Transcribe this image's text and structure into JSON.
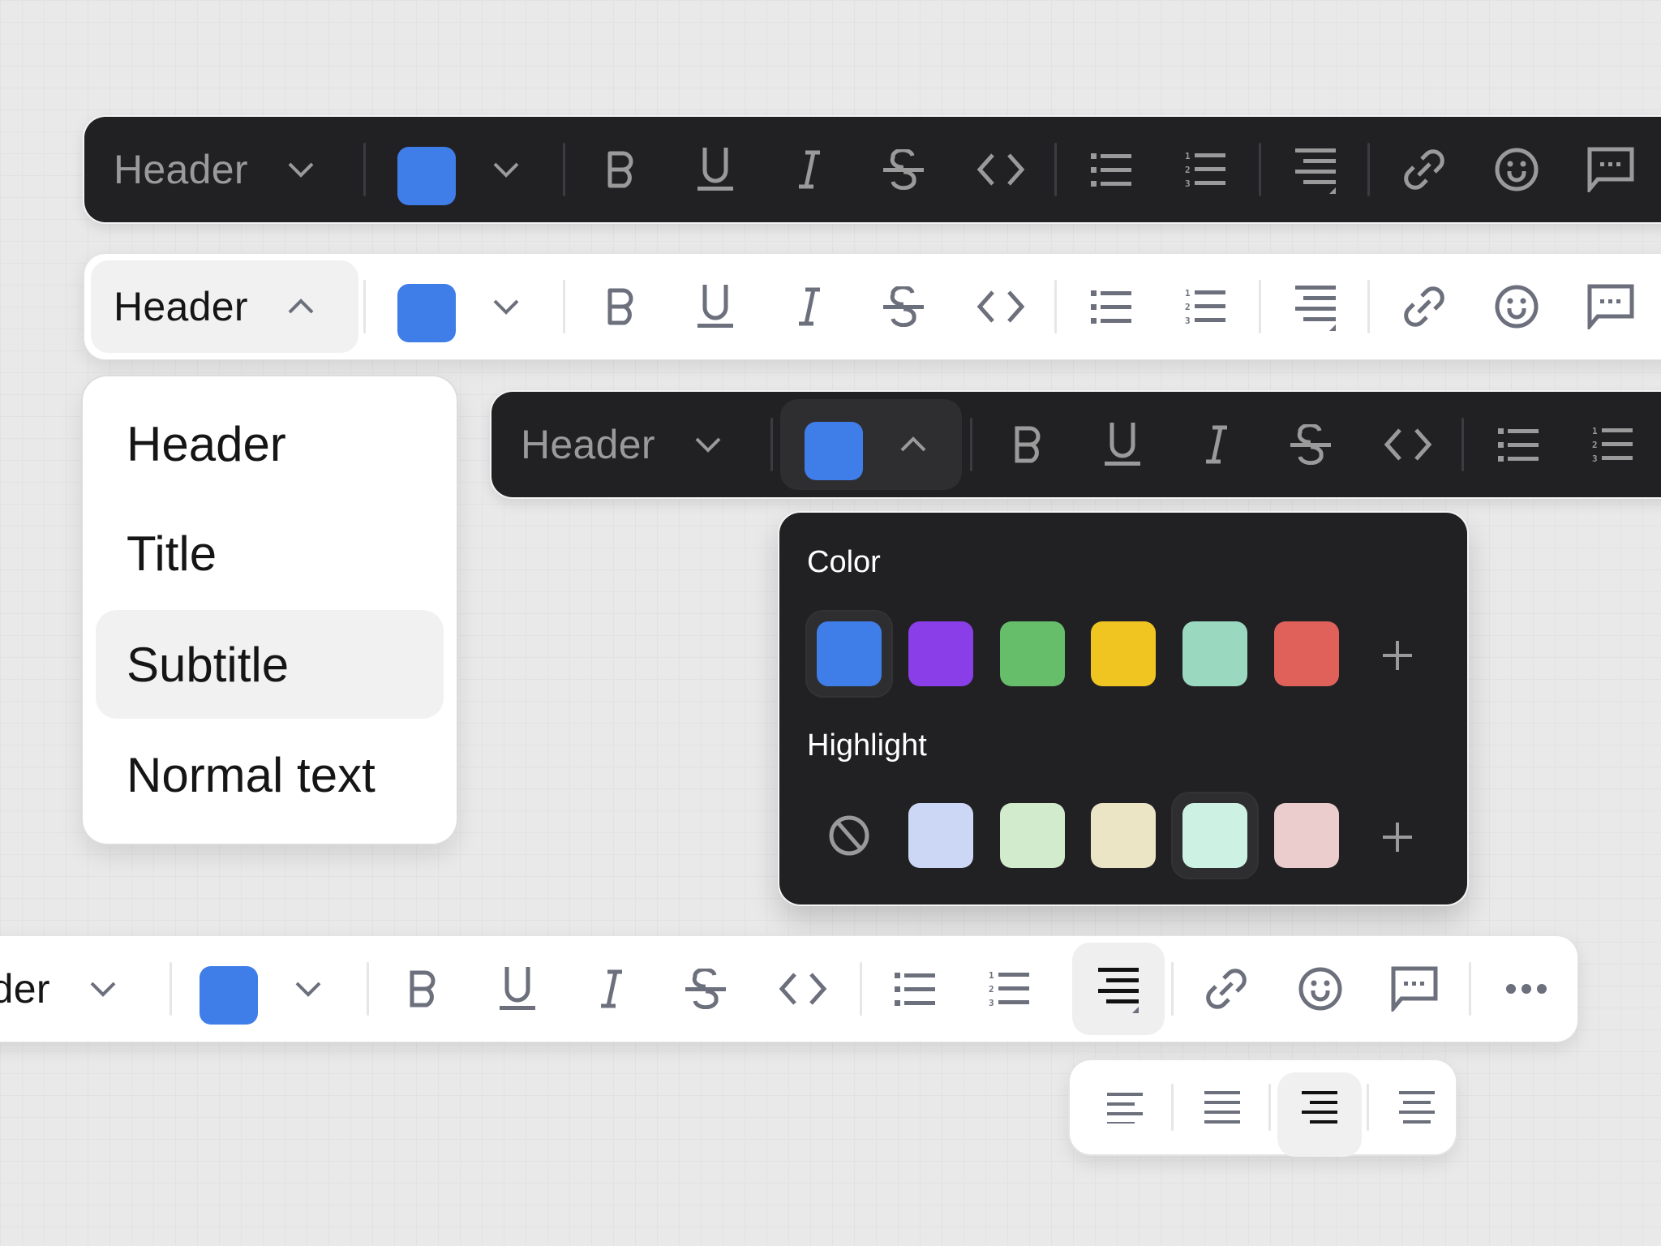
{
  "toolbars": {
    "dark_top": {
      "style_select": {
        "label": "Header",
        "state": "collapsed"
      },
      "color": {
        "value": "#3f7de8",
        "state": "collapsed"
      }
    },
    "light_open_style": {
      "style_select": {
        "label": "Header",
        "state": "expanded"
      },
      "color": {
        "value": "#3f7de8",
        "state": "collapsed"
      }
    },
    "dark_open_color": {
      "style_select": {
        "label": "Header",
        "state": "collapsed"
      },
      "color": {
        "value": "#3f7de8",
        "state": "expanded"
      }
    },
    "light_bottom": {
      "style_select": {
        "label": "Header",
        "visible_label": "der",
        "state": "collapsed"
      },
      "color": {
        "value": "#3f7de8",
        "state": "collapsed"
      },
      "align_active": true
    }
  },
  "tools": [
    {
      "name": "bold",
      "icon": "bold-icon"
    },
    {
      "name": "underline",
      "icon": "underline-icon"
    },
    {
      "name": "italic",
      "icon": "italic-icon"
    },
    {
      "name": "strikethrough",
      "icon": "strikethrough-icon"
    },
    {
      "name": "code",
      "icon": "code-icon"
    },
    {
      "name": "bulleted-list",
      "icon": "bulleted-list-icon"
    },
    {
      "name": "numbered-list",
      "icon": "numbered-list-icon"
    },
    {
      "name": "align",
      "icon": "align-right-icon"
    },
    {
      "name": "link",
      "icon": "link-icon"
    },
    {
      "name": "emoji",
      "icon": "emoji-icon"
    },
    {
      "name": "comment",
      "icon": "comment-icon"
    },
    {
      "name": "more",
      "icon": "more-icon"
    }
  ],
  "style_dropdown": {
    "items": [
      {
        "label": "Header",
        "active": false
      },
      {
        "label": "Title",
        "active": false
      },
      {
        "label": "Subtitle",
        "active": true
      },
      {
        "label": "Normal text",
        "active": false
      }
    ]
  },
  "color_popup": {
    "color_label": "Color",
    "highlight_label": "Highlight",
    "colors": [
      "#3f7de8",
      "#8a3ee8",
      "#66bd6a",
      "#f0c522",
      "#9ad8c0",
      "#e0615a"
    ],
    "selected_color": "#3f7de8",
    "highlights": [
      "none",
      "#cbd7f4",
      "#d3ebcd",
      "#ebe5c6",
      "#cdf2e3",
      "#ebcdcd"
    ],
    "selected_highlight": "#cdf2e3",
    "add_label": "+"
  },
  "align_popup": {
    "options": [
      "align-left",
      "align-justify",
      "align-right",
      "align-center"
    ],
    "selected": "align-right"
  }
}
